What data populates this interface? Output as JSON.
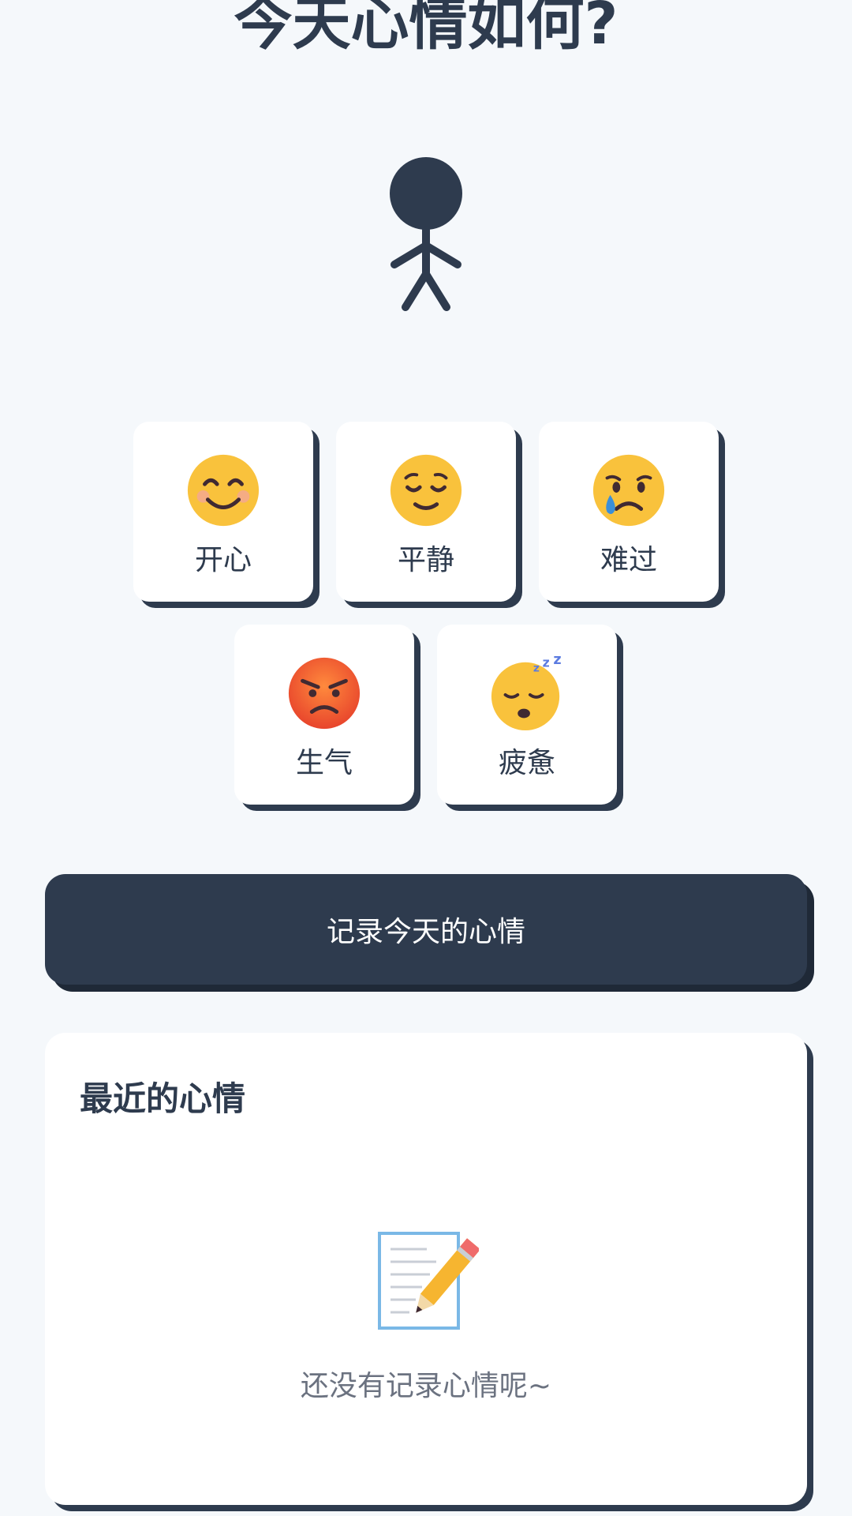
{
  "header": {
    "title": "今天心情如何?"
  },
  "moods": [
    {
      "label": "开心",
      "icon": "smiling-face-icon"
    },
    {
      "label": "平静",
      "icon": "relieved-face-icon"
    },
    {
      "label": "难过",
      "icon": "crying-face-icon"
    },
    {
      "label": "生气",
      "icon": "angry-face-icon"
    },
    {
      "label": "疲惫",
      "icon": "sleepy-face-icon"
    }
  ],
  "actions": {
    "record_label": "记录今天的心情"
  },
  "recent": {
    "title": "最近的心情",
    "empty_icon": "memo-pencil-icon",
    "empty_text": "还没有记录心情呢~"
  },
  "colors": {
    "primary": "#2e3b4e",
    "background": "#f5f8fb",
    "card": "#ffffff",
    "emoji_yellow": "#f9c23c",
    "muted_text": "#6b7280"
  }
}
